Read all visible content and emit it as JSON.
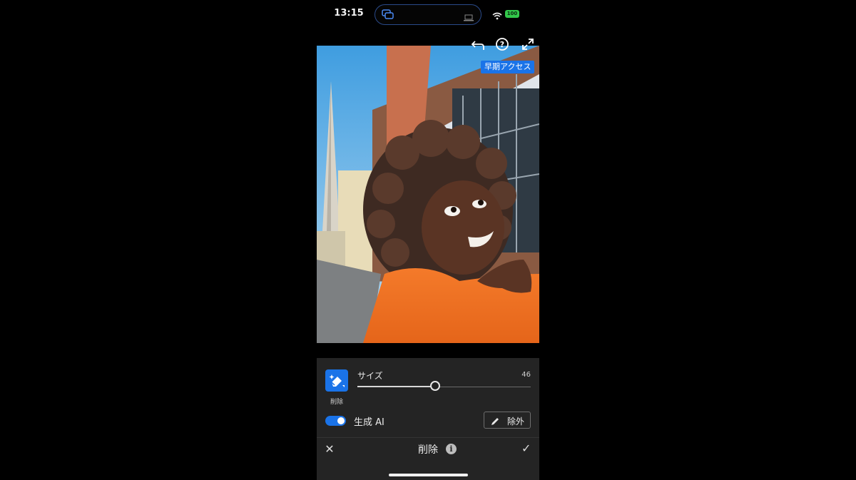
{
  "status_bar": {
    "time": "13:15",
    "battery": "100"
  },
  "toolbar_icons": [
    "undo-icon",
    "help-icon",
    "expand-icon"
  ],
  "badge": "早期アクセス",
  "tool": {
    "icon": "eraser-sparkle-icon",
    "label": "削除"
  },
  "size": {
    "label": "サイズ",
    "value": "46",
    "level": 0.46
  },
  "generative_ai": {
    "label": "生成 AI",
    "enabled": true
  },
  "exclude_button": {
    "label": "除外",
    "icon": "pencil-icon"
  },
  "bottom_bar": {
    "close_symbol": "✕",
    "title": "削除",
    "info_symbol": "i",
    "confirm_symbol": "✓"
  },
  "colors": {
    "accent": "#1a73e8",
    "panel": "#242424",
    "background": "#000000"
  }
}
